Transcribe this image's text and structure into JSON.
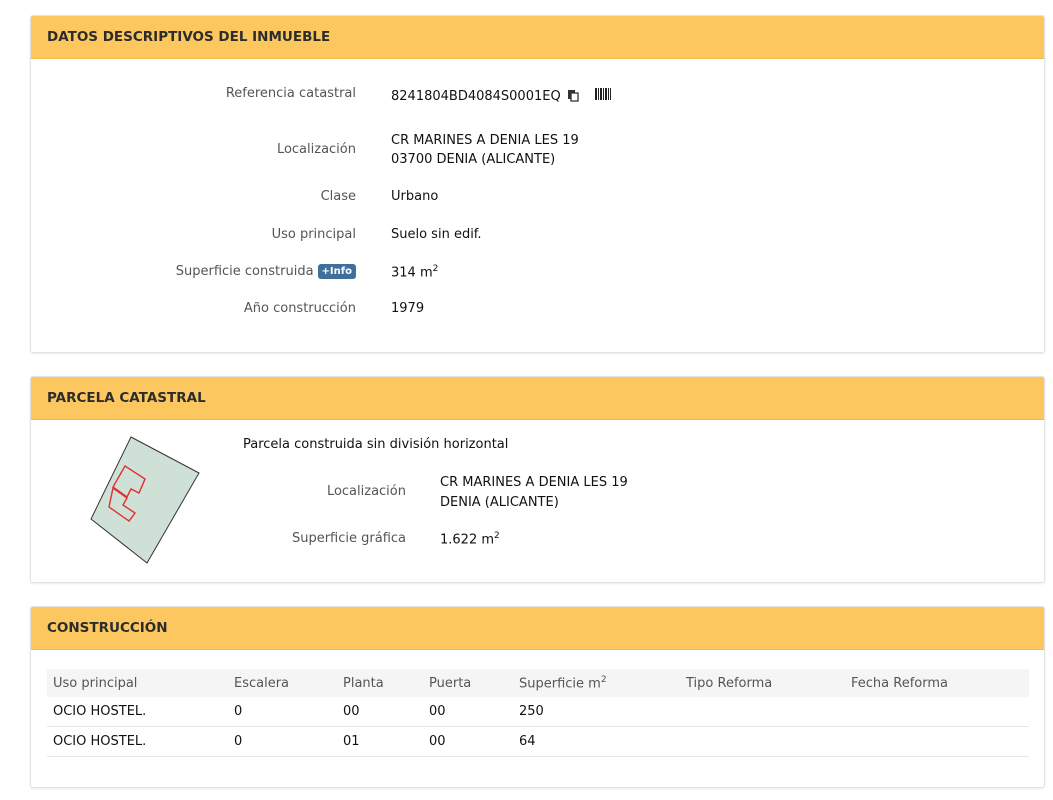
{
  "datos": {
    "title": "DATOS DESCRIPTIVOS DEL INMUEBLE",
    "ref_label": "Referencia catastral",
    "ref_value": "8241804BD4084S0001EQ",
    "loc_label": "Localización",
    "loc_line1": "CR MARINES A DENIA LES 19",
    "loc_line2": "03700 DENIA (ALICANTE)",
    "clase_label": "Clase",
    "clase_value": "Urbano",
    "uso_label": "Uso principal",
    "uso_value": "Suelo sin edif.",
    "sup_label": "Superficie construida",
    "info_badge": "+Info",
    "sup_value": "314 m",
    "sup_unit_exp": "2",
    "anio_label": "Año construcción",
    "anio_value": "1979"
  },
  "parcela": {
    "title": "PARCELA CATASTRAL",
    "subtitle": "Parcela construida sin división horizontal",
    "loc_label": "Localización",
    "loc_line1": "CR MARINES A DENIA LES 19",
    "loc_line2": "DENIA (ALICANTE)",
    "sup_label": "Superficie gráfica",
    "sup_value": "1.622 m",
    "sup_unit_exp": "2"
  },
  "construccion": {
    "title": "CONSTRUCCIÓN",
    "headers": [
      "Uso principal",
      "Escalera",
      "Planta",
      "Puerta",
      "Superficie m",
      "Tipo Reforma",
      "Fecha Reforma"
    ],
    "sup_header_exp": "2",
    "rows": [
      [
        "OCIO HOSTEL.",
        "0",
        "00",
        "00",
        "250",
        "",
        ""
      ],
      [
        "OCIO HOSTEL.",
        "0",
        "01",
        "00",
        "64",
        "",
        ""
      ]
    ]
  },
  "colors": {
    "header_bg": "#fdc75f",
    "badge_bg": "#3f6f9a",
    "parcel_fill": "#cfe0d6",
    "building_stroke": "#e03030"
  },
  "icons": [
    "copy-icon",
    "barcode-icon",
    "parcel-map-icon"
  ]
}
